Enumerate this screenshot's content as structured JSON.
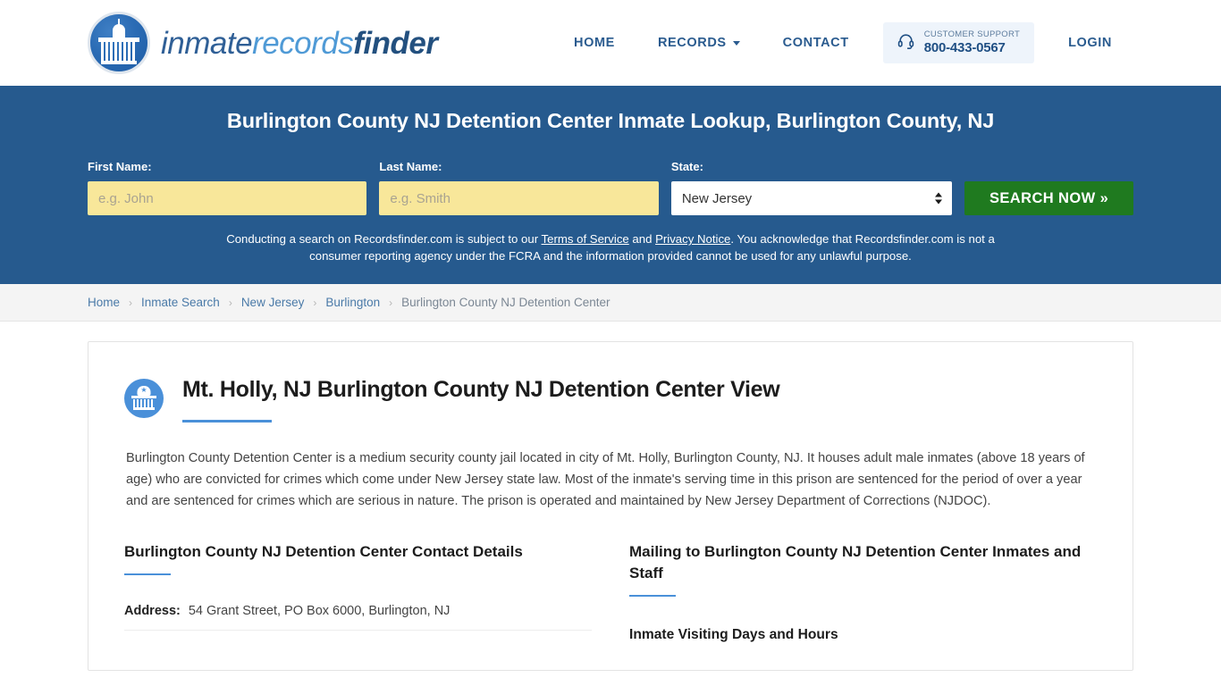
{
  "header": {
    "brand": {
      "part1": "inmate",
      "part2": "records",
      "part3": "finder"
    },
    "nav": [
      {
        "label": "HOME",
        "has_caret": false
      },
      {
        "label": "RECORDS",
        "has_caret": true
      },
      {
        "label": "CONTACT",
        "has_caret": false
      }
    ],
    "support": {
      "label": "CUSTOMER SUPPORT",
      "phone": "800-433-0567"
    },
    "login_label": "LOGIN"
  },
  "hero": {
    "title": "Burlington County NJ Detention Center Inmate Lookup, Burlington County, NJ",
    "first_name": {
      "label": "First Name:",
      "placeholder": "e.g. John",
      "value": ""
    },
    "last_name": {
      "label": "Last Name:",
      "placeholder": "e.g. Smith",
      "value": ""
    },
    "state": {
      "label": "State:",
      "selected": "New Jersey"
    },
    "search_button": "SEARCH NOW »",
    "disclaimer": {
      "part1": "Conducting a search on Recordsfinder.com is subject to our ",
      "link1": "Terms of Service",
      "part2": " and ",
      "link2": "Privacy Notice",
      "part3": ". You acknowledge that Recordsfinder.com is not a consumer reporting agency under the FCRA and the information provided cannot be used for any unlawful purpose."
    },
    "bg_color": "#265a8e",
    "button_color": "#1f7a1f",
    "input_color": "#f8e79a"
  },
  "breadcrumb": {
    "separator": "›",
    "items": [
      {
        "label": "Home",
        "current": false
      },
      {
        "label": "Inmate Search",
        "current": false
      },
      {
        "label": "New Jersey",
        "current": false
      },
      {
        "label": "Burlington",
        "current": false
      },
      {
        "label": "Burlington County NJ Detention Center",
        "current": true
      }
    ]
  },
  "main": {
    "page_title": "Mt. Holly, NJ Burlington County NJ Detention Center View",
    "intro": "Burlington County Detention Center is a medium security county jail located in city of Mt. Holly, Burlington County, NJ. It houses adult male inmates (above 18 years of age) who are convicted for crimes which come under New Jersey state law. Most of the inmate's serving time in this prison are sentenced for the period of over a year and are sentenced for crimes which are serious in nature. The prison is operated and maintained by New Jersey Department of Corrections (NJDOC).",
    "left_column": {
      "heading": "Burlington County NJ Detention Center Contact Details",
      "rows": [
        {
          "key": "Address:",
          "value": "54 Grant Street, PO Box 6000, Burlington, NJ"
        }
      ]
    },
    "right_column": {
      "heading": "Mailing to Burlington County NJ Detention Center Inmates and Staff",
      "sub_heading": "Inmate Visiting Days and Hours"
    },
    "accent_color": "#4a90d9"
  }
}
